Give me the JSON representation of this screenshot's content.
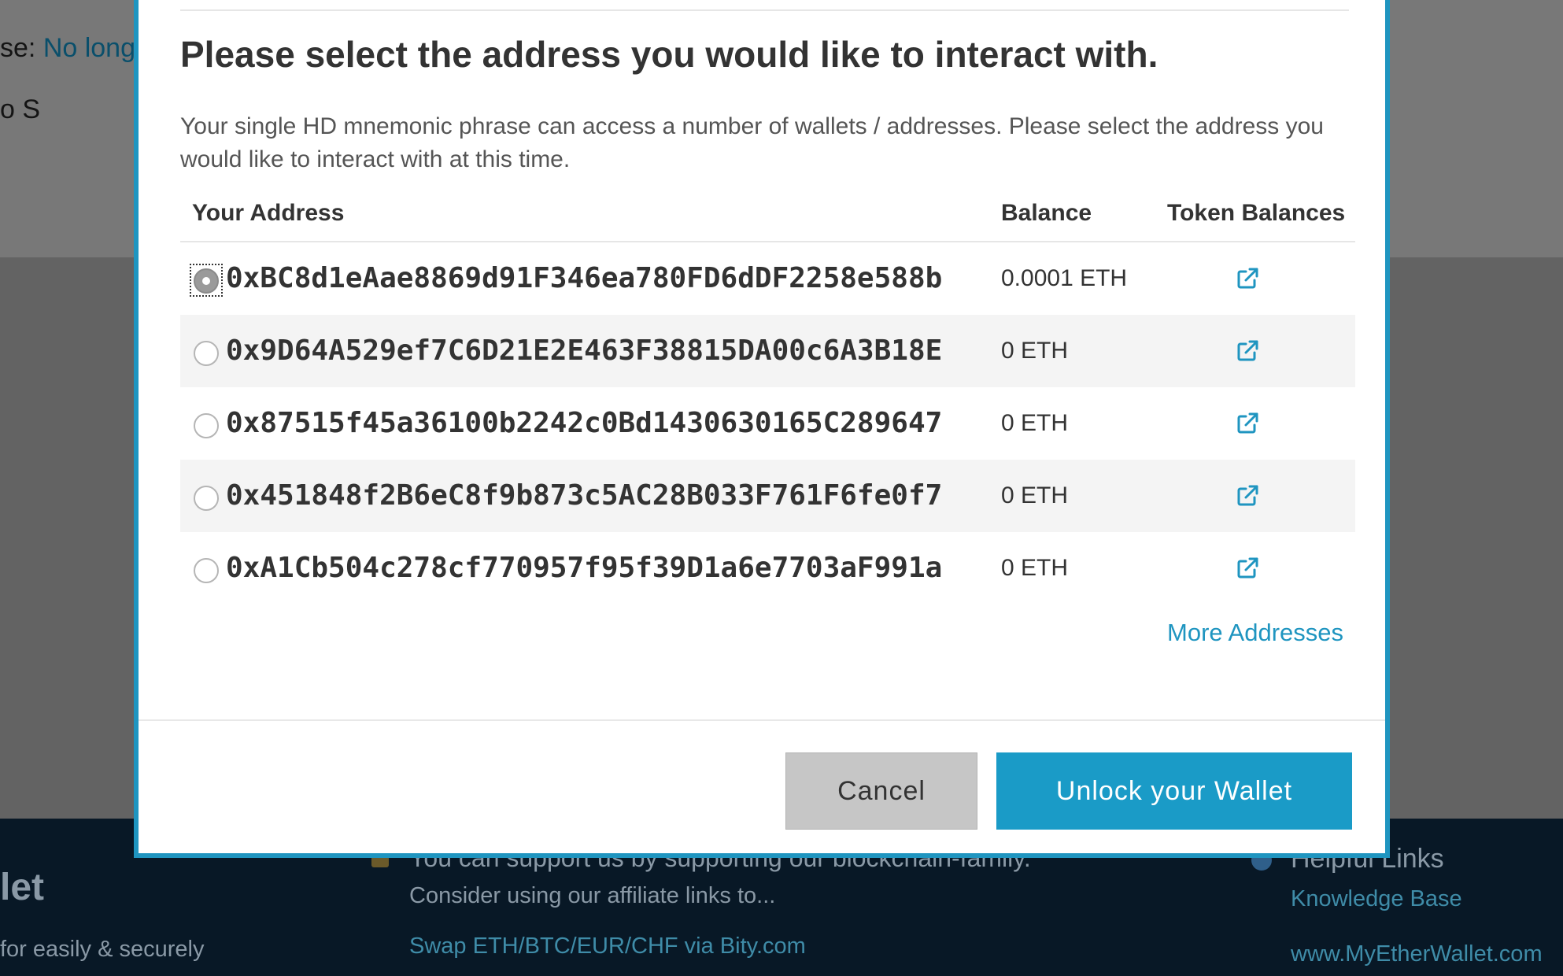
{
  "background": {
    "label1_prefix": "se: ",
    "label1_link": "No long",
    "label2": "o S",
    "footer": {
      "brand": "let",
      "tagline": "for easily & securely",
      "support_heading": "You can support us by supporting our blockchain-family.",
      "support_text": "Consider using our affiliate links to...",
      "bity_link": "Swap ETH/BTC/EUR/CHF via Bity.com",
      "helpful_heading": "Helpful Links",
      "knowledge_base": "Knowledge Base",
      "mew_link": "www.MyEtherWallet.com"
    }
  },
  "modal": {
    "title": "Please select the address you would like to interact with.",
    "description": "Your single HD mnemonic phrase can access a number of wallets / addresses. Please select the address you would like to interact with at this time.",
    "columns": {
      "address": "Your Address",
      "balance": "Balance",
      "token_balances": "Token Balances"
    },
    "rows": [
      {
        "address": "0xBC8d1eAae8869d91F346ea780FD6dDF2258e588b",
        "balance": "0.0001 ETH",
        "selected": true
      },
      {
        "address": "0x9D64A529ef7C6D21E2E463F38815DA00c6A3B18E",
        "balance": "0 ETH",
        "selected": false
      },
      {
        "address": "0x87515f45a36100b2242c0Bd1430630165C289647",
        "balance": "0 ETH",
        "selected": false
      },
      {
        "address": "0x451848f2B6eC8f9b873c5AC28B033F761F6fe0f7",
        "balance": "0 ETH",
        "selected": false
      },
      {
        "address": "0xA1Cb504c278cf770957f95f39D1a6e7703aF991a",
        "balance": "0 ETH",
        "selected": false
      }
    ],
    "token_icon": "external-link-icon",
    "more_addresses": "More Addresses",
    "cancel_label": "Cancel",
    "unlock_label": "Unlock your Wallet"
  },
  "colors": {
    "accent": "#1f95c0",
    "unlock_button": "#1a9bc7",
    "cancel_button": "#c6c6c6",
    "footer_bg": "#081826"
  }
}
